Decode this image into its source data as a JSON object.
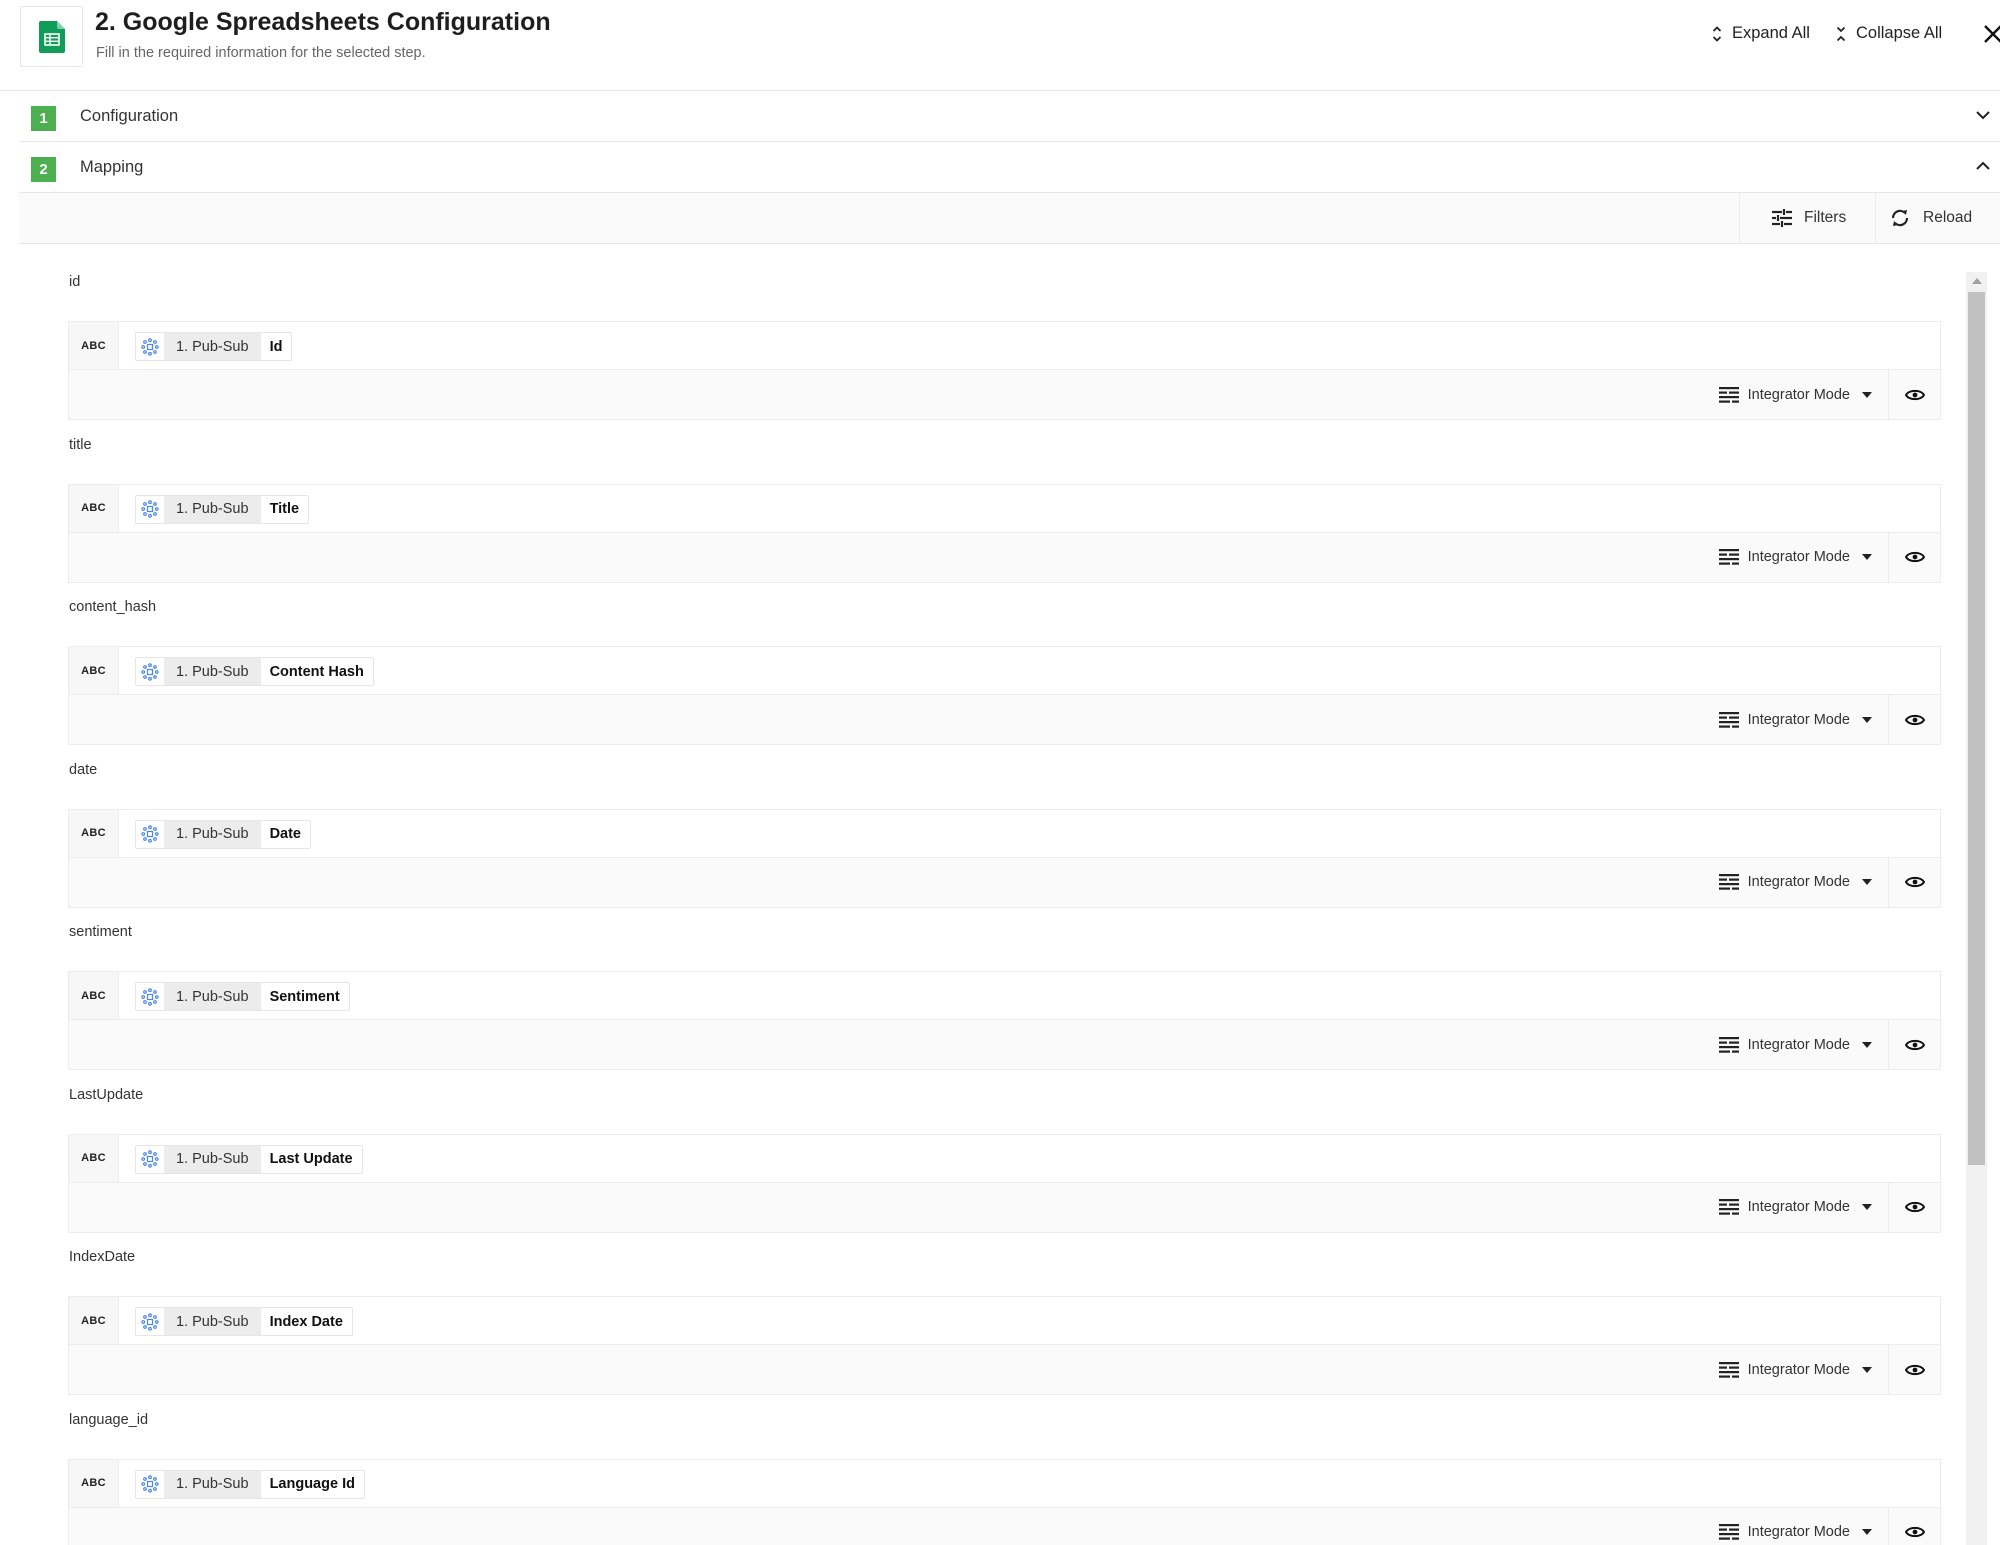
{
  "header": {
    "title": "2. Google Spreadsheets Configuration",
    "subtitle": "Fill in the required information for the selected step.",
    "app_icon": "google-sheets-icon",
    "expand_all": "Expand All",
    "collapse_all": "Collapse All",
    "close_icon": "close-icon"
  },
  "accordion": [
    {
      "number": "1",
      "label": "Configuration",
      "state": "collapsed"
    },
    {
      "number": "2",
      "label": "Mapping",
      "state": "expanded"
    }
  ],
  "toolbar": {
    "filters": "Filters",
    "reload": "Reload"
  },
  "fields": [
    {
      "label": "id",
      "type": "ABC",
      "source": "1. Pub-Sub",
      "value": "Id",
      "mode": "Integrator Mode"
    },
    {
      "label": "title",
      "type": "ABC",
      "source": "1. Pub-Sub",
      "value": "Title",
      "mode": "Integrator Mode"
    },
    {
      "label": "content_hash",
      "type": "ABC",
      "source": "1. Pub-Sub",
      "value": "Content Hash",
      "mode": "Integrator Mode"
    },
    {
      "label": "date",
      "type": "ABC",
      "source": "1. Pub-Sub",
      "value": "Date",
      "mode": "Integrator Mode"
    },
    {
      "label": "sentiment",
      "type": "ABC",
      "source": "1. Pub-Sub",
      "value": "Sentiment",
      "mode": "Integrator Mode"
    },
    {
      "label": "LastUpdate",
      "type": "ABC",
      "source": "1. Pub-Sub",
      "value": "Last Update",
      "mode": "Integrator Mode"
    },
    {
      "label": "IndexDate",
      "type": "ABC",
      "source": "1. Pub-Sub",
      "value": "Index Date",
      "mode": "Integrator Mode"
    },
    {
      "label": "language_id",
      "type": "ABC",
      "source": "1. Pub-Sub",
      "value": "Language Id",
      "mode": "Integrator Mode"
    }
  ],
  "colors": {
    "step_badge": "#4caf50",
    "sheets_green": "#0f9d58",
    "pubsub_icon": "#4a86e8"
  }
}
